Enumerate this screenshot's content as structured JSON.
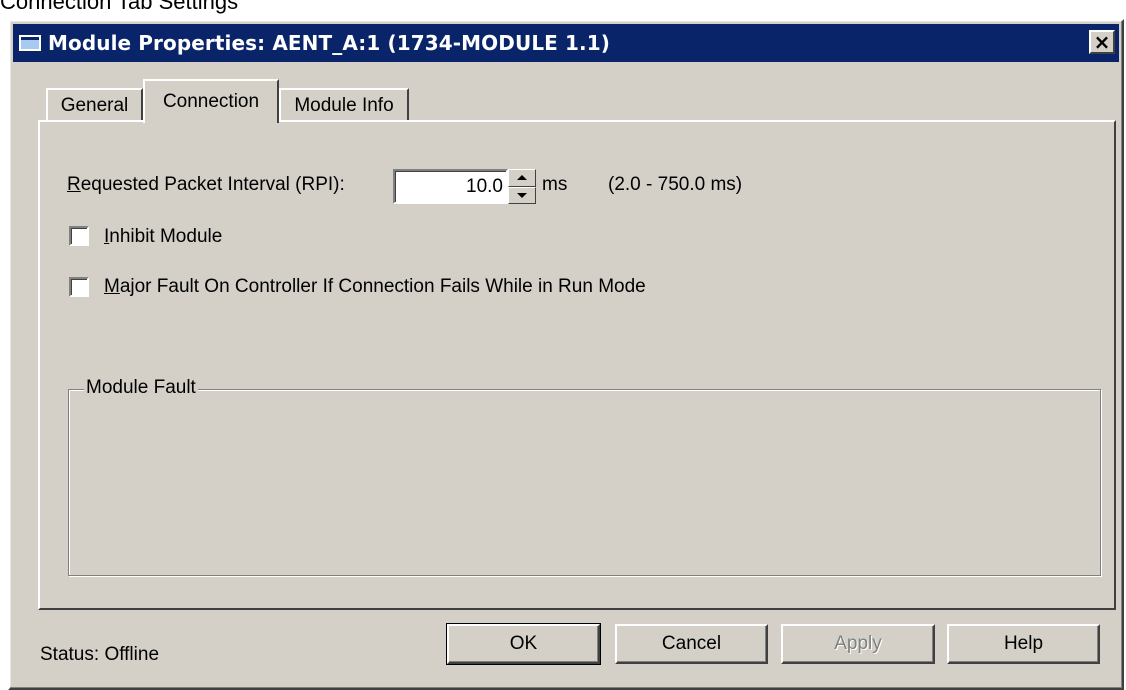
{
  "page_caption": "Connection Tab Settings",
  "window": {
    "title": "Module Properties: AENT_A:1 (1734-MODULE 1.1)",
    "close_glyph": "×"
  },
  "tabs": [
    {
      "label": "General",
      "active": false
    },
    {
      "label": "Connection",
      "active": true
    },
    {
      "label": "Module Info",
      "active": false
    }
  ],
  "connection": {
    "rpi": {
      "label_underlined": "R",
      "label_rest": "equested Packet Interval (RPI):",
      "value": "10.0",
      "unit": "ms",
      "range": "(2.0 - 750.0 ms)"
    },
    "inhibit_module": {
      "label_underlined": "I",
      "label_rest": "nhibit Module",
      "checked": false
    },
    "major_fault": {
      "label_underlined": "M",
      "label_rest": "ajor Fault On Controller If Connection Fails While in Run Mode",
      "checked": false
    },
    "module_fault": {
      "legend": "Module Fault"
    }
  },
  "footer": {
    "status_label": "Status:",
    "status_value": "Offline",
    "buttons": {
      "ok": "OK",
      "cancel": "Cancel",
      "apply": "Apply",
      "help": "Help"
    }
  },
  "colors": {
    "titlebar": "#0a246a",
    "face": "#d4d0c8"
  }
}
